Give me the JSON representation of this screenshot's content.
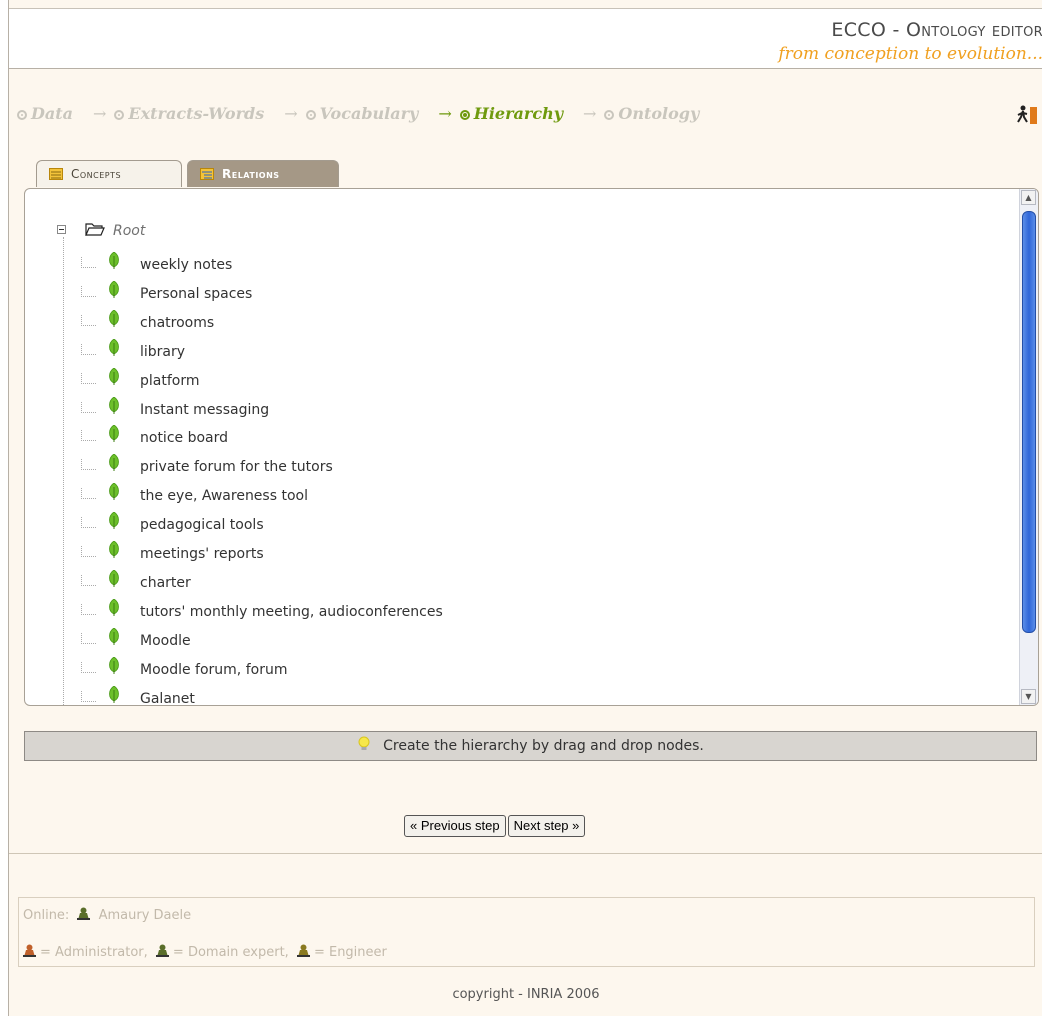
{
  "header": {
    "brand_prefix": "ECCO - ",
    "brand_title": "Ontology editor",
    "brand_subtitle": "from conception to evolution..."
  },
  "steps": [
    {
      "label": "Data",
      "active": false
    },
    {
      "label": "Extracts-Words",
      "active": false
    },
    {
      "label": "Vocabulary",
      "active": false
    },
    {
      "label": "Hierarchy",
      "active": true
    },
    {
      "label": "Ontology",
      "active": false
    }
  ],
  "tabs": {
    "concepts": "Concepts",
    "relations": "Relations"
  },
  "tree": {
    "root": "Root",
    "items": [
      "weekly notes",
      "Personal spaces",
      "chatrooms",
      "library",
      "platform",
      "Instant messaging",
      "notice board",
      "private forum for the tutors",
      "the eye, Awareness tool",
      "pedagogical tools",
      "meetings' reports",
      "charter",
      "tutors' monthly meeting, audioconferences",
      "Moodle",
      "Moodle forum, forum",
      "Galanet"
    ]
  },
  "hint": "Create the hierarchy by drag and drop nodes.",
  "nav": {
    "previous": "« Previous step",
    "next": "Next step »"
  },
  "online": {
    "label": "Online:",
    "user": "Amaury Daele",
    "legend_admin": "= Administrator,",
    "legend_expert": "= Domain expert,",
    "legend_engineer": "= Engineer"
  },
  "footer": {
    "copyright": "copyright - INRIA 2006"
  },
  "colors": {
    "active_step": "#6f9a0e",
    "inactive_step": "#c9c6bd",
    "brand_subtitle": "#f0a020",
    "admin_icon": "#c0602a",
    "expert_icon": "#5a6e2a",
    "engineer_icon": "#8a7a20"
  }
}
